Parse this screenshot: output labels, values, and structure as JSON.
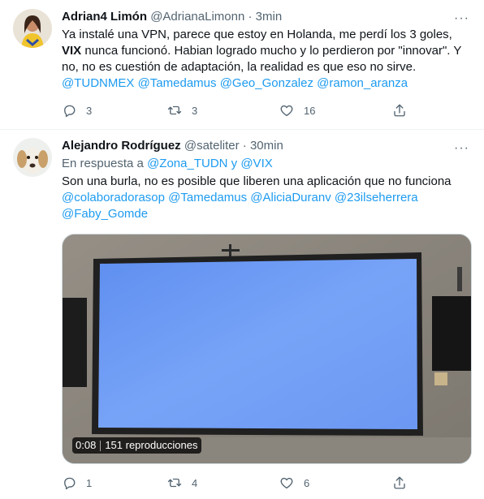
{
  "tweets": [
    {
      "display_name": "Adrian4 Limón",
      "handle": "@AdrianaLimonn",
      "separator": "·",
      "time": "3min",
      "text_parts": [
        "Ya instalé una VPN, parece que estoy en Holanda, me perdí los 3 goles, ",
        "VIX",
        " nunca funcionó. Habian logrado mucho y lo perdieron por \"innovar\". Y no, no es cuestión de adaptación, la realidad es que eso no sirve."
      ],
      "mentions": [
        "@TUDNMEX",
        "@Tamedamus",
        "@Geo_Gonzalez",
        "@ramon_aranza"
      ],
      "stats": {
        "replies": "3",
        "retweets": "3",
        "likes": "16"
      }
    },
    {
      "display_name": "Alejandro Rodríguez",
      "handle": "@sateliter",
      "separator": "·",
      "time": "30min",
      "reply_prefix": "En respuesta a ",
      "reply_mentions": "@Zona_TUDN y @VIX",
      "text": "Son una burla, no es posible que liberen una aplicación que no funciona",
      "mentions": [
        "@colaboradorasop",
        "@Tamedamus",
        "@AliciaDuranv",
        "@23ilseherrera",
        "@Faby_Gomde"
      ],
      "video": {
        "duration": "0:08",
        "views": "151 reproducciones"
      },
      "stats": {
        "replies": "1",
        "retweets": "4",
        "likes": "6"
      }
    }
  ],
  "icons": {
    "more": "more-icon",
    "reply": "reply-icon",
    "retweet": "retweet-icon",
    "like": "like-icon",
    "share": "share-icon"
  },
  "colors": {
    "mention": "#1d9bf0",
    "secondary": "#536471",
    "text": "#0f1419",
    "screen_blue": "#6d9df6"
  }
}
